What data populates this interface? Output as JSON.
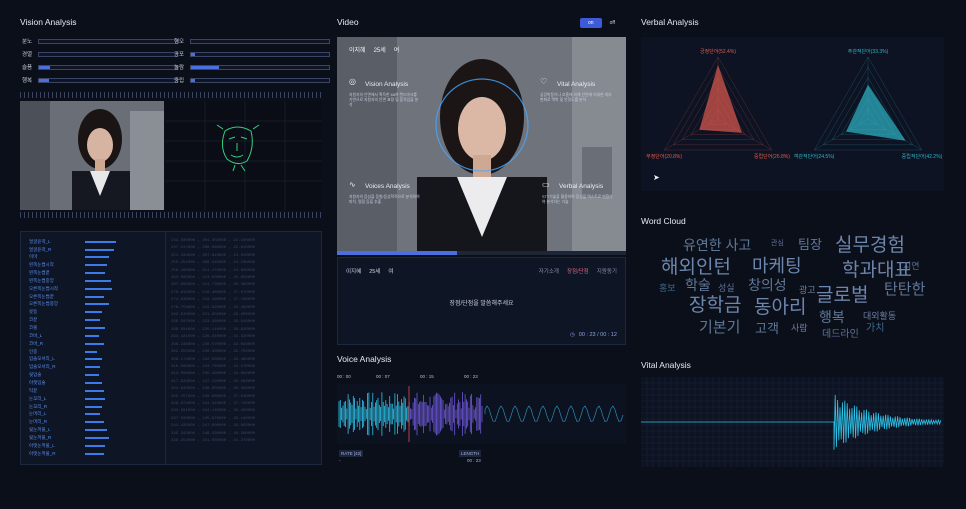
{
  "vision": {
    "title": "Vision Analysis",
    "metrics_left": [
      {
        "label": "분노",
        "value": 0.0
      },
      {
        "label": "경멸",
        "value": 0.0
      },
      {
        "label": "슬픔",
        "value": 0.08
      },
      {
        "label": "행복",
        "value": 0.07
      }
    ],
    "metrics_right": [
      {
        "label": "혐오",
        "value": 0.0
      },
      {
        "label": "공포",
        "value": 0.03
      },
      {
        "label": "놀람",
        "value": 0.2
      },
      {
        "label": "중립",
        "value": 0.03
      }
    ],
    "list_items": [
      {
        "name": "얼굴윤곽_L",
        "value": 0.9
      },
      {
        "name": "얼굴윤곽_R",
        "value": 0.85
      },
      {
        "name": "이마",
        "value": 0.7
      },
      {
        "name": "왼쪽눈썹시작",
        "value": 0.65
      },
      {
        "name": "왼쪽눈썹끝",
        "value": 0.6
      },
      {
        "name": "왼쪽눈썹중앙",
        "value": 0.75
      },
      {
        "name": "오른쪽눈썹시작",
        "value": 0.8
      },
      {
        "name": "오른쪽눈썹끝",
        "value": 0.55
      },
      {
        "name": "오른쪽눈썹중앙",
        "value": 0.7
      },
      {
        "name": "콧등",
        "value": 0.5
      },
      {
        "name": "코끝",
        "value": 0.45
      },
      {
        "name": "코볼",
        "value": 0.6
      },
      {
        "name": "코바_L",
        "value": 0.4
      },
      {
        "name": "코바_R",
        "value": 0.55
      },
      {
        "name": "인중",
        "value": 0.35
      },
      {
        "name": "입술모서리_L",
        "value": 0.5
      },
      {
        "name": "입술모서리_R",
        "value": 0.45
      },
      {
        "name": "윗입술",
        "value": 0.4
      },
      {
        "name": "아랫입술",
        "value": 0.5
      },
      {
        "name": "턱끝",
        "value": 0.55
      },
      {
        "name": "눈꼬리_L",
        "value": 0.6
      },
      {
        "name": "눈꼬리_R",
        "value": 0.5
      },
      {
        "name": "눈머리_L",
        "value": 0.45
      },
      {
        "name": "눈머리_R",
        "value": 0.55
      },
      {
        "name": "윗눈꺼풀_L",
        "value": 0.65
      },
      {
        "name": "윗눈꺼풀_R",
        "value": 0.7
      },
      {
        "name": "아랫눈꺼풀_L",
        "value": 0.6
      },
      {
        "name": "아랫눈꺼풀_R",
        "value": 0.55
      }
    ],
    "numbers_text": "243.564983",
    "video_overlay": {
      "vision_title": "Vision Analysis",
      "vision_desc": "지원자의 안면에서 획득한 68개 랜드마크를 기반으로 지원자의 안면 표정 및 움직임을 분석",
      "vital_title": "Vital Analysis",
      "vital_desc": "심장박동이나 호흡에 의해 안면에 미세한 피부 변화로 맥박 및 안정도를 분석",
      "voices_title": "Voices Analysis",
      "voices_desc": "지원자의 음성을 음향/음성학적으로 분석하여 피치, 떨림 등을 추출",
      "verbal_title": "Verbal Analysis",
      "verbal_desc": "STT기술을 활용하여 음성을 텍스트로 변환하여 분석하는 기술"
    }
  },
  "video": {
    "title": "Video",
    "toggle_on": "on",
    "toggle_off": "off",
    "name_tag": "이지혜",
    "age_tag": "25세",
    "gender_tag": "여",
    "info_name": "이지혜",
    "info_age": "25세",
    "info_gender": "여",
    "tabs": [
      "자기소개",
      "장점/단점",
      "지원동기"
    ],
    "active_tab": 1,
    "prompt": "장점/단점을 말씀해주세요",
    "timer": "00 : 23 / 00 : 12"
  },
  "voice": {
    "title": "Voice Analysis",
    "timeline": [
      "00 : 00",
      "00 : 07",
      "00 : 15",
      "00 : 23"
    ],
    "rate_label": "RATE [42]",
    "length_label": "LENGTH",
    "length_value": "00 : 23",
    "dash": "-"
  },
  "verbal": {
    "title": "Verbal Analysis",
    "radar_left": [
      {
        "label": "긍정단어(52.4%)",
        "value": 52.4
      },
      {
        "label": "중립단어(26.8%)",
        "value": 26.8
      },
      {
        "label": "부정단어(20.8%)",
        "value": 20.8
      }
    ],
    "radar_right": [
      {
        "label": "주관적단어(33.3%)",
        "value": 33.3
      },
      {
        "label": "중립적단어(42.2%)",
        "value": 42.2
      },
      {
        "label": "객관적단어(24.5%)",
        "value": 24.5
      }
    ],
    "colors": {
      "left": "#e05a4f",
      "right": "#2fb5c7"
    }
  },
  "wordcloud": {
    "title": "Word Cloud",
    "words": [
      {
        "text": "유연한 사고",
        "size": 14
      },
      {
        "text": "관심",
        "size": 7
      },
      {
        "text": "팀장",
        "size": 13
      },
      {
        "text": "실무경험",
        "size": 19
      },
      {
        "text": "해외인턴",
        "size": 19
      },
      {
        "text": "마케팅",
        "size": 18
      },
      {
        "text": "학과대표",
        "size": 19
      },
      {
        "text": "지연",
        "size": 9
      },
      {
        "text": "홍보",
        "size": 9
      },
      {
        "text": "학술",
        "size": 14
      },
      {
        "text": "성실",
        "size": 9
      },
      {
        "text": "창의성",
        "size": 14
      },
      {
        "text": "광고",
        "size": 9
      },
      {
        "text": "글로벌",
        "size": 19
      },
      {
        "text": "탄탄한",
        "size": 15
      },
      {
        "text": "장학금",
        "size": 19
      },
      {
        "text": "동아리",
        "size": 19
      },
      {
        "text": "행복",
        "size": 14
      },
      {
        "text": "대외활동",
        "size": 9
      },
      {
        "text": "기본기",
        "size": 15
      },
      {
        "text": "고객",
        "size": 13
      },
      {
        "text": "사람",
        "size": 9
      },
      {
        "text": "데드라인",
        "size": 10
      },
      {
        "text": "가치",
        "size": 10
      }
    ]
  },
  "vital": {
    "title": "Vital Analysis"
  }
}
